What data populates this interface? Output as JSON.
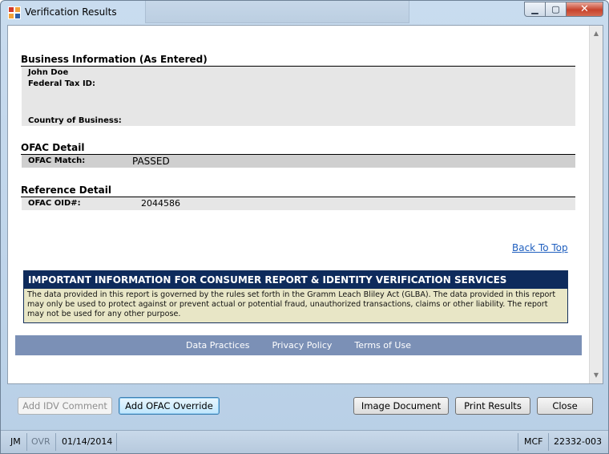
{
  "window": {
    "title": "Verification Results"
  },
  "business": {
    "heading": "Business Information (As Entered)",
    "name": "John Doe",
    "tax_label": "Federal Tax ID:",
    "country_label": "Country of Business:"
  },
  "ofac": {
    "heading": "OFAC Detail",
    "match_label": "OFAC Match:",
    "match_value": "PASSED"
  },
  "reference": {
    "heading": "Reference Detail",
    "oid_label": "OFAC OID#:",
    "oid_value": "2044586"
  },
  "back_to_top": "Back To Top",
  "notice": {
    "heading": "IMPORTANT INFORMATION FOR CONSUMER REPORT & IDENTITY VERIFICATION SERVICES",
    "body": "The data provided in this report is governed by the rules set forth in the Gramm Leach Bliley Act (GLBA). The data provided in this report may only be used to protect against or prevent actual or potential fraud, unauthorized transactions, claims or other liability. The report may not be used for any other purpose."
  },
  "footer_links": [
    "Data Practices",
    "Privacy Policy",
    "Terms of Use"
  ],
  "buttons": {
    "add_idv_comment": "Add IDV Comment",
    "add_ofac_override": "Add OFAC Override",
    "image_document": "Image Document",
    "print_results": "Print Results",
    "close": "Close"
  },
  "status": {
    "user": "JM",
    "mode": "OVR",
    "date": "01/14/2014",
    "code": "MCF",
    "id": "22332-003"
  },
  "icons": {
    "app": "app-logo-icon",
    "minimize": "minimize-icon",
    "maximize": "maximize-icon",
    "close": "close-icon"
  }
}
